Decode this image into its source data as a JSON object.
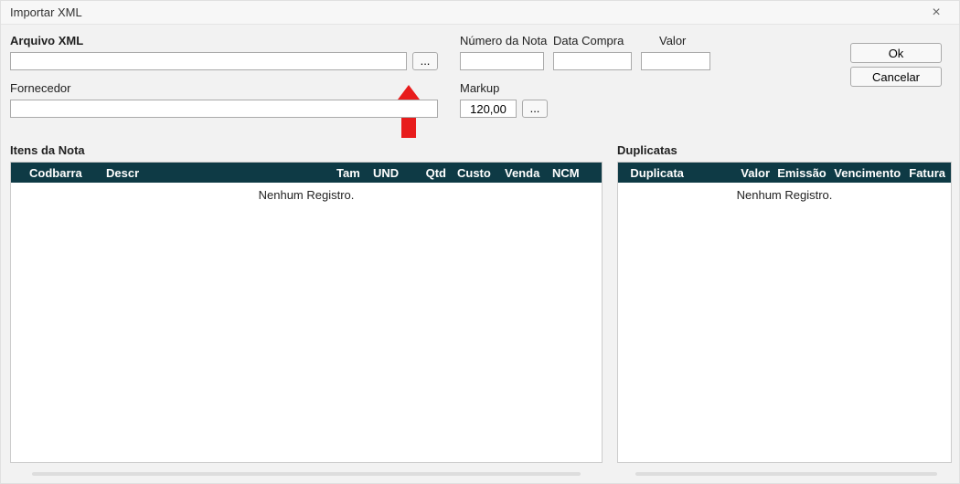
{
  "window": {
    "title": "Importar XML"
  },
  "form": {
    "arquivo_xml_label": "Arquivo XML",
    "numero_nota_label": "Número da Nota",
    "data_compra_label": "Data Compra",
    "valor_label": "Valor",
    "fornecedor_label": "Fornecedor",
    "markup_label": "Markup",
    "markup_value": "120,00",
    "browse_label": "..."
  },
  "buttons": {
    "ok": "Ok",
    "cancel": "Cancelar"
  },
  "sections": {
    "itens_label": "Itens da Nota",
    "duplicatas_label": "Duplicatas"
  },
  "itens_grid": {
    "columns": [
      "Codbarra",
      "Descr",
      "Tam",
      "UND",
      "Qtd",
      "Custo",
      "Venda",
      "NCM"
    ],
    "empty_text": "Nenhum Registro."
  },
  "duplicatas_grid": {
    "columns": [
      "Duplicata",
      "Valor",
      "Emissão",
      "Vencimento",
      "Fatura"
    ],
    "empty_text": "Nenhum Registro."
  }
}
